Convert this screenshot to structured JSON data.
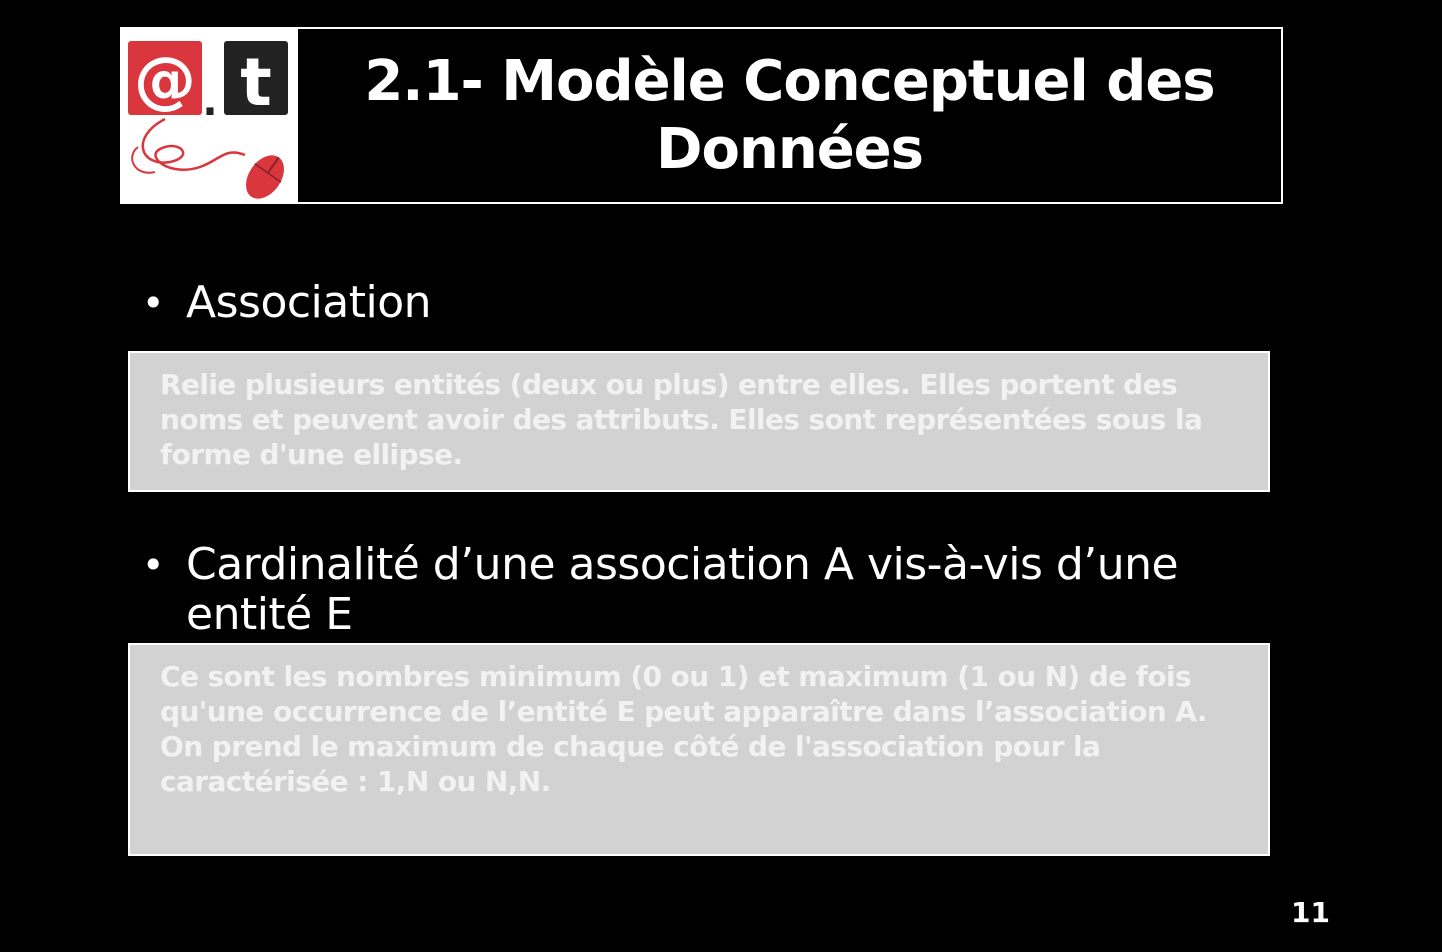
{
  "header": {
    "logo": {
      "at_symbol": "@",
      "dot": ".",
      "letter": "t"
    },
    "title": "2.1- Modèle Conceptuel des\nDonnées"
  },
  "sections": [
    {
      "bullet": "Association",
      "definition": "Relie plusieurs entités (deux ou plus) entre elles. Elles portent des noms et peuvent avoir des attributs. Elles sont représentées sous la forme d'une ellipse."
    },
    {
      "bullet": "Cardinalité d’une association A vis-à-vis d’une entité E",
      "definition": "Ce sont les nombres minimum (0 ou 1) et maximum (1 ou N) de fois qu'une occurrence de l’entité E peut apparaître dans l’association A. On prend le maximum de chaque côté de l'association pour la caractérisée : 1,N ou N,N."
    }
  ],
  "page_number": "11",
  "colors": {
    "background": "#000000",
    "logo_red": "#d9363e",
    "logo_dark": "#222222",
    "box_fill": "#d2d2d2",
    "box_text": "#f2f2f2"
  },
  "icons": {
    "logo": "at-t-mouse-logo-icon",
    "bullet": "bullet-dot-icon"
  }
}
